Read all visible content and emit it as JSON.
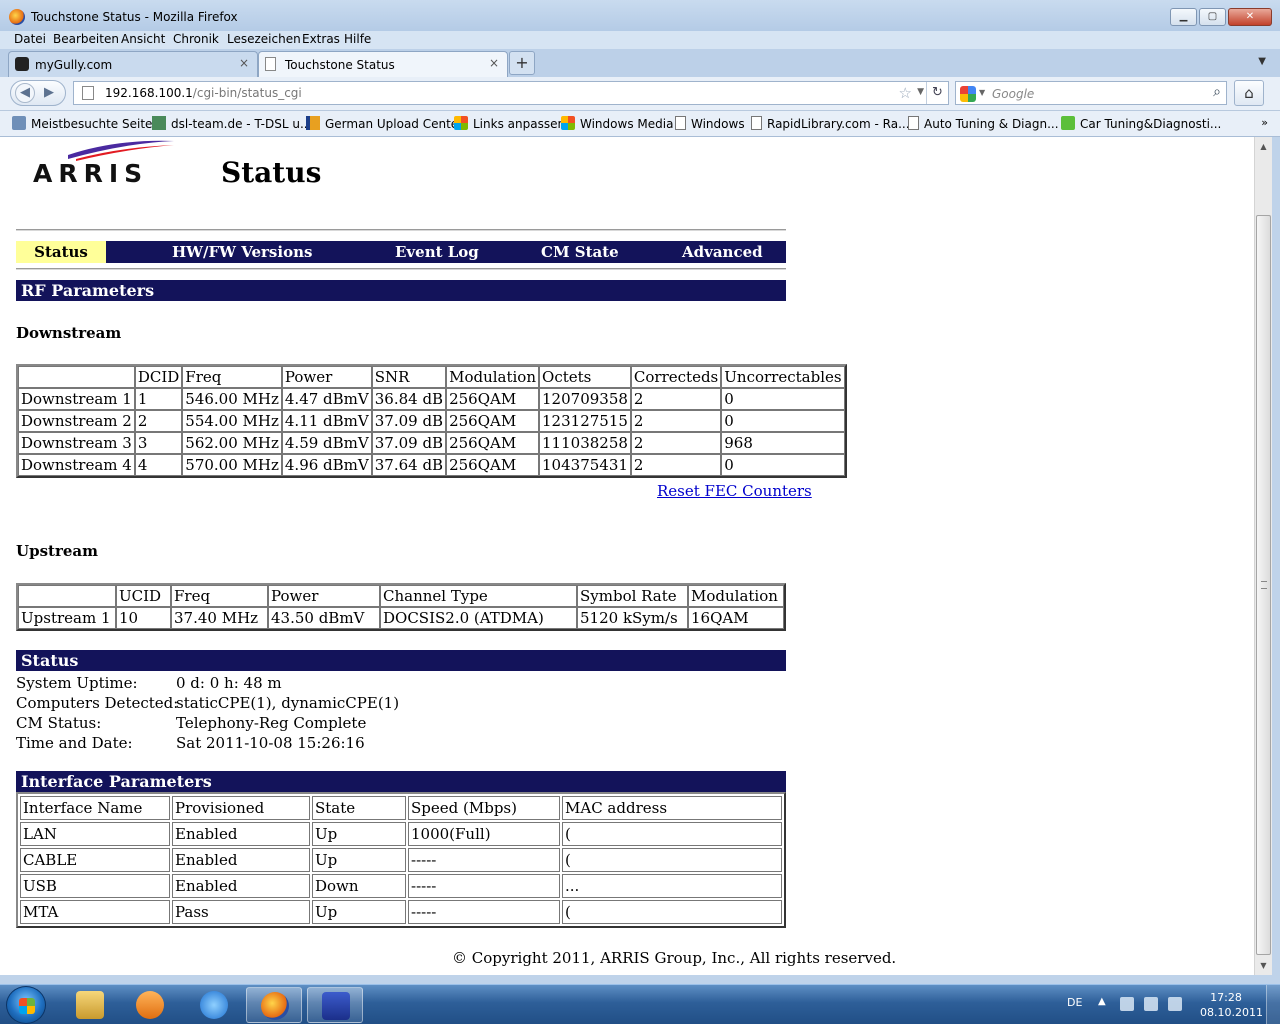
{
  "window": {
    "title": "Touchstone Status - Mozilla Firefox",
    "minimize": "▁",
    "maximize": "▢",
    "close": "✕"
  },
  "menu": [
    "Datei",
    "Bearbeiten",
    "Ansicht",
    "Chronik",
    "Lesezeichen",
    "Extras",
    "Hilfe"
  ],
  "tabs": [
    {
      "label": "myGully.com",
      "close": "×"
    },
    {
      "label": "Touchstone Status",
      "close": "×"
    }
  ],
  "new_tab": "+",
  "address": {
    "host": "192.168.100.1",
    "path": "/cgi-bin/status_cgi"
  },
  "search": {
    "placeholder": "Google"
  },
  "bookmarks": [
    "Meistbesuchte Seiten",
    "dsl-team.de - T-DSL u...",
    "German Upload Center",
    "Links anpassen",
    "Windows Media",
    "Windows",
    "RapidLibrary.com - Ra...",
    "Auto Tuning & Diagn...",
    "Car Tuning&Diagnosti..."
  ],
  "bookmarks_more": "»",
  "page": {
    "logo_text": "ARRIS",
    "title": "Status",
    "nav": [
      "Status",
      "HW/FW Versions",
      "Event Log",
      "CM State",
      "Advanced"
    ],
    "rf_title": "RF Parameters",
    "downstream_title": "Downstream",
    "downstream": {
      "headers": [
        "",
        "DCID",
        "Freq",
        "Power",
        "SNR",
        "Modulation",
        "Octets",
        "Correcteds",
        "Uncorrectables"
      ],
      "rows": [
        [
          "Downstream 1",
          "1",
          "546.00 MHz",
          "4.47 dBmV",
          "36.84 dB",
          "256QAM",
          "120709358",
          "2",
          "0"
        ],
        [
          "Downstream 2",
          "2",
          "554.00 MHz",
          "4.11 dBmV",
          "37.09 dB",
          "256QAM",
          "123127515",
          "2",
          "0"
        ],
        [
          "Downstream 3",
          "3",
          "562.00 MHz",
          "4.59 dBmV",
          "37.09 dB",
          "256QAM",
          "111038258",
          "2",
          "968"
        ],
        [
          "Downstream 4",
          "4",
          "570.00 MHz",
          "4.96 dBmV",
          "37.64 dB",
          "256QAM",
          "104375431",
          "2",
          "0"
        ]
      ]
    },
    "reset_link": "Reset FEC Counters",
    "upstream_title": "Upstream",
    "upstream": {
      "headers": [
        "",
        "UCID",
        "Freq",
        "Power",
        "Channel Type",
        "Symbol Rate",
        "Modulation"
      ],
      "rows": [
        [
          "Upstream 1",
          "10",
          "37.40 MHz",
          "43.50 dBmV",
          "DOCSIS2.0 (ATDMA)",
          "5120 kSym/s",
          "16QAM"
        ]
      ]
    },
    "status_title": "Status",
    "status": [
      {
        "label": "System Uptime:",
        "value": "0 d: 0 h: 48 m"
      },
      {
        "label": "Computers Detected:",
        "value": "staticCPE(1), dynamicCPE(1)"
      },
      {
        "label": "CM Status:",
        "value": "Telephony-Reg Complete"
      },
      {
        "label": "Time and Date:",
        "value": "Sat 2011-10-08 15:26:16"
      }
    ],
    "iface_title": "Interface Parameters",
    "iface": {
      "headers": [
        "Interface Name",
        "Provisioned",
        "State",
        "Speed (Mbps)",
        "MAC address"
      ],
      "rows": [
        [
          "LAN",
          "Enabled",
          "Up",
          "1000(Full)",
          "("
        ],
        [
          "CABLE",
          "Enabled",
          "Up",
          "-----",
          "("
        ],
        [
          "USB",
          "Enabled",
          "Down",
          "-----",
          "..."
        ],
        [
          "MTA",
          "Pass",
          "Up",
          "-----",
          "("
        ]
      ]
    },
    "copyright": "© Copyright 2011, ARRIS Group, Inc., All rights reserved."
  },
  "taskbar": {
    "lang": "DE",
    "time": "17:28",
    "date": "08.10.2011"
  }
}
